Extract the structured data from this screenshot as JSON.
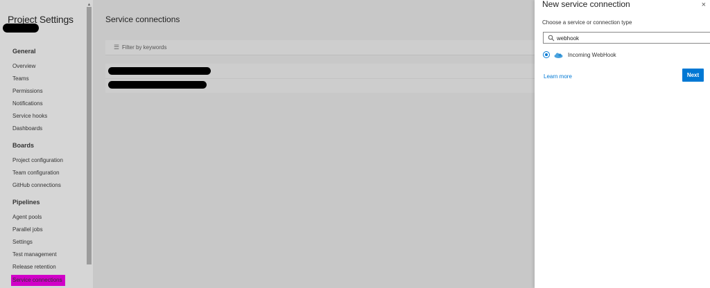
{
  "sidebar": {
    "title": "Project Settings",
    "sections": [
      {
        "heading": "General",
        "items": [
          "Overview",
          "Teams",
          "Permissions",
          "Notifications",
          "Service hooks",
          "Dashboards"
        ]
      },
      {
        "heading": "Boards",
        "items": [
          "Project configuration",
          "Team configuration",
          "GitHub connections"
        ]
      },
      {
        "heading": "Pipelines",
        "items": [
          "Agent pools",
          "Parallel jobs",
          "Settings",
          "Test management",
          "Release retention",
          "Service connections"
        ]
      }
    ],
    "active_item": "Service connections"
  },
  "main": {
    "title": "Service connections",
    "filter_placeholder": "Filter by keywords"
  },
  "panel": {
    "title": "New service connection",
    "close_label": "×",
    "subtitle": "Choose a service or connection type",
    "search_value": "webhook",
    "option_label": "Incoming WebHook",
    "learn_more": "Learn more",
    "next_label": "Next"
  },
  "colors": {
    "accent": "#0078d4",
    "highlight": "#d100c8",
    "overlay": "#c8c8c8"
  },
  "icons": [
    "filter-icon",
    "search-icon",
    "webhook-icon",
    "close-icon"
  ]
}
